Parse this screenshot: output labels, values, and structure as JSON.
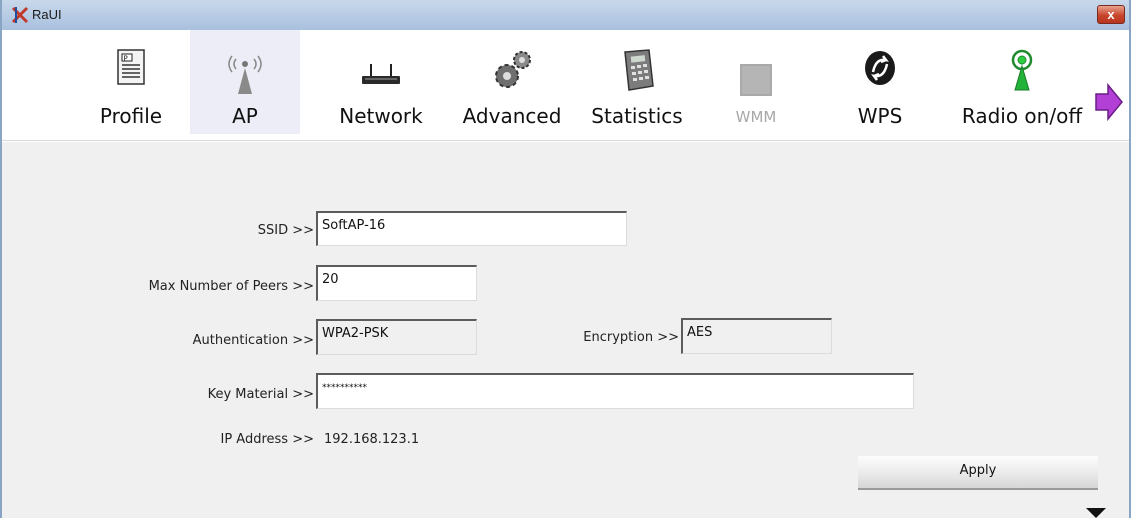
{
  "window": {
    "title": "RaUI",
    "close_label": "x",
    "close_color": "#c7452c"
  },
  "toolbar": {
    "items": [
      {
        "label": "Profile",
        "icon": "profile-icon",
        "active": false,
        "disabled": false
      },
      {
        "label": "AP",
        "icon": "ap-icon",
        "active": true,
        "disabled": false
      },
      {
        "label": "Network",
        "icon": "network-icon",
        "active": false,
        "disabled": false
      },
      {
        "label": "Advanced",
        "icon": "advanced-icon",
        "active": false,
        "disabled": false
      },
      {
        "label": "Statistics",
        "icon": "statistics-icon",
        "active": false,
        "disabled": false
      },
      {
        "label": "WMM",
        "icon": "wmm-icon",
        "active": false,
        "disabled": true
      },
      {
        "label": "WPS",
        "icon": "wps-icon",
        "active": false,
        "disabled": false
      },
      {
        "label": "Radio on/off",
        "icon": "radio-icon",
        "active": false,
        "disabled": false
      }
    ],
    "next_icon": "arrow-right-icon"
  },
  "form": {
    "ssid": {
      "label": "SSID >>",
      "value": "SoftAP-16"
    },
    "max_peers": {
      "label": "Max Number of Peers >>",
      "value": "20"
    },
    "authentication": {
      "label": "Authentication >>",
      "value": "WPA2-PSK"
    },
    "encryption": {
      "label": "Encryption >>",
      "value": "AES"
    },
    "key_material": {
      "label": "Key Material >>",
      "value": "**********"
    },
    "ip_address": {
      "label": "IP Address >>",
      "value": "192.168.123.1"
    },
    "apply_label": "Apply"
  }
}
